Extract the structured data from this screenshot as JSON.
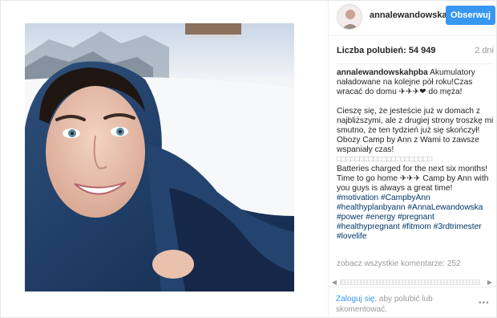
{
  "header": {
    "username": "annalewandowska..",
    "follow_label": "Obserwuj"
  },
  "stats": {
    "likes_label": "Liczba polubień: 54 949",
    "age": "2 dni"
  },
  "caption": {
    "author": "annalewandowskahpba",
    "line1": " Akumulatory naładowane na kolejne pół roku!Czas wracać do domu ✈✈✈❤ do męża!",
    "line2": "Cieszę się, że jesteście już w domach z najbliższymi, ale z drugiej strony troszkę mi smutno, że ten tydzień już się skończył!",
    "line3": "Obozy Camp by Ann z Wami to zawsze wspaniały czas!",
    "line4": "□□□□□□□□□□□□□□□□□□□□□",
    "line5": "Batteries charged for the next six months! Time to go home ✈✈✈ Camp by Ann with you guys is always a great time!",
    "hashtags": [
      "#motivation",
      "#CampbyAnn",
      "#healthyplanbyann",
      "#AnnaLewandowska",
      "#power",
      "#energy",
      "#pregnant",
      "#healthypregnant",
      "#fitmom",
      "#3rdtrimester",
      "#lovelife"
    ]
  },
  "view_all_comments": "zobacz wszystkie komentarze: 252",
  "footer": {
    "login_link": "Zaloguj się",
    "login_text": ", aby polubić lub skomentować.",
    "more_icon": "•••"
  },
  "icons": {
    "more": "more-dots-icon",
    "scroll_left": "scroll-left-icon",
    "scroll_right": "scroll-right-icon"
  },
  "colors": {
    "accent": "#3897f0",
    "hashtag": "#003569",
    "muted": "#999999",
    "text": "#262626"
  }
}
